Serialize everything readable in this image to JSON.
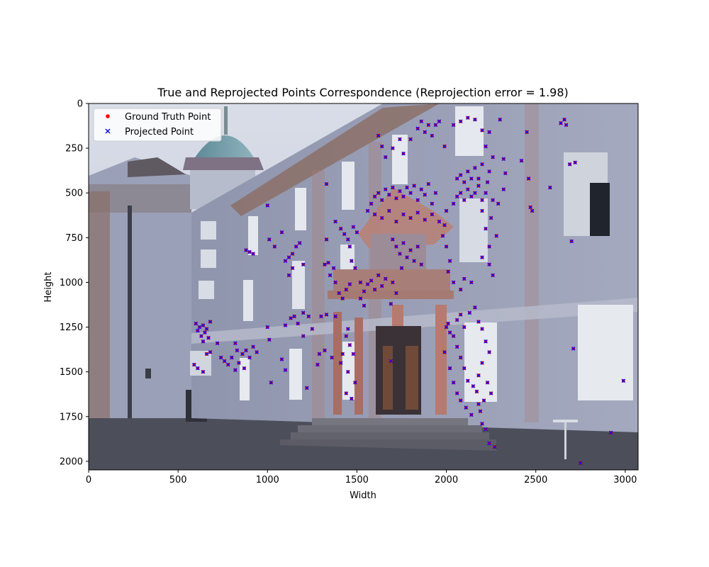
{
  "chart_data": {
    "type": "scatter",
    "title": "True and Reprojected Points Correspondence (Reprojection error = 1.98)",
    "xlabel": "Width",
    "ylabel": "Height",
    "xlim": [
      0,
      3072
    ],
    "ylim": [
      2048,
      0
    ],
    "x_ticks": [
      0,
      500,
      1000,
      1500,
      2000,
      2500,
      3000
    ],
    "y_ticks": [
      0,
      250,
      500,
      750,
      1000,
      1250,
      1500,
      1750,
      2000
    ],
    "grid": false,
    "legend_position": "top-left",
    "background": "photograph of a baroque palace facade with a central balcony over a columned entrance",
    "series": [
      {
        "name": "Ground Truth Point",
        "marker": "circle",
        "color": "#ff0000"
      },
      {
        "name": "Projected Point",
        "marker": "x",
        "color": "#0000ff"
      }
    ],
    "points": [
      [
        1330,
        450
      ],
      [
        1380,
        660
      ],
      [
        1410,
        700
      ],
      [
        1430,
        730
      ],
      [
        1450,
        760
      ],
      [
        1480,
        690
      ],
      [
        1500,
        720
      ],
      [
        1460,
        800
      ],
      [
        1470,
        880
      ],
      [
        1490,
        920
      ],
      [
        1520,
        1000
      ],
      [
        1540,
        1050
      ],
      [
        1560,
        1010
      ],
      [
        1580,
        990
      ],
      [
        1600,
        1040
      ],
      [
        1620,
        960
      ],
      [
        1640,
        1020
      ],
      [
        1660,
        980
      ],
      [
        1700,
        1000
      ],
      [
        1720,
        1060
      ],
      [
        1560,
        600
      ],
      [
        1580,
        560
      ],
      [
        1600,
        520
      ],
      [
        1620,
        500
      ],
      [
        1640,
        540
      ],
      [
        1660,
        480
      ],
      [
        1680,
        510
      ],
      [
        1700,
        470
      ],
      [
        1720,
        530
      ],
      [
        1740,
        490
      ],
      [
        1760,
        520
      ],
      [
        1780,
        470
      ],
      [
        1800,
        500
      ],
      [
        1820,
        460
      ],
      [
        1840,
        540
      ],
      [
        1860,
        480
      ],
      [
        1880,
        510
      ],
      [
        1900,
        450
      ],
      [
        1920,
        560
      ],
      [
        1940,
        500
      ],
      [
        1600,
        620
      ],
      [
        1640,
        640
      ],
      [
        1680,
        600
      ],
      [
        1720,
        660
      ],
      [
        1760,
        620
      ],
      [
        1800,
        640
      ],
      [
        1840,
        610
      ],
      [
        1880,
        650
      ],
      [
        1920,
        620
      ],
      [
        1960,
        660
      ],
      [
        1700,
        760
      ],
      [
        1720,
        800
      ],
      [
        1740,
        840
      ],
      [
        1760,
        780
      ],
      [
        1780,
        860
      ],
      [
        1800,
        820
      ],
      [
        1820,
        880
      ],
      [
        1840,
        800
      ],
      [
        1860,
        900
      ],
      [
        1750,
        920
      ],
      [
        2040,
        560
      ],
      [
        2060,
        520
      ],
      [
        2080,
        500
      ],
      [
        2100,
        540
      ],
      [
        2120,
        480
      ],
      [
        2140,
        520
      ],
      [
        2160,
        500
      ],
      [
        2180,
        460
      ],
      [
        2200,
        540
      ],
      [
        2220,
        500
      ],
      [
        2080,
        400
      ],
      [
        2120,
        380
      ],
      [
        2160,
        360
      ],
      [
        2200,
        340
      ],
      [
        2240,
        380
      ],
      [
        2060,
        420
      ],
      [
        2140,
        420
      ],
      [
        2180,
        420
      ],
      [
        2100,
        440
      ],
      [
        2230,
        440
      ],
      [
        2000,
        600
      ],
      [
        1990,
        680
      ],
      [
        1980,
        740
      ],
      [
        2000,
        800
      ],
      [
        2020,
        880
      ],
      [
        2010,
        940
      ],
      [
        2040,
        1000
      ],
      [
        2080,
        1040
      ],
      [
        2100,
        980
      ],
      [
        2140,
        1000
      ],
      [
        2240,
        900
      ],
      [
        2260,
        960
      ],
      [
        2200,
        860
      ],
      [
        2240,
        800
      ],
      [
        2280,
        740
      ],
      [
        2220,
        700
      ],
      [
        2250,
        640
      ],
      [
        2200,
        600
      ],
      [
        2290,
        560
      ],
      [
        2260,
        540
      ],
      [
        1620,
        180
      ],
      [
        1640,
        240
      ],
      [
        1660,
        300
      ],
      [
        1700,
        250
      ],
      [
        1740,
        200
      ],
      [
        1760,
        280
      ],
      [
        1800,
        200
      ],
      [
        1840,
        140
      ],
      [
        1860,
        100
      ],
      [
        1880,
        160
      ],
      [
        1900,
        120
      ],
      [
        1920,
        180
      ],
      [
        1940,
        120
      ],
      [
        1960,
        100
      ],
      [
        1990,
        240
      ],
      [
        2040,
        120
      ],
      [
        2080,
        100
      ],
      [
        2120,
        80
      ],
      [
        2160,
        90
      ],
      [
        2200,
        150
      ],
      [
        2240,
        160
      ],
      [
        2220,
        240
      ],
      [
        2260,
        300
      ],
      [
        2300,
        90
      ],
      [
        2320,
        310
      ],
      [
        2330,
        390
      ],
      [
        2320,
        480
      ],
      [
        2420,
        320
      ],
      [
        2450,
        160
      ],
      [
        2460,
        420
      ],
      [
        2470,
        580
      ],
      [
        2480,
        600
      ],
      [
        2580,
        470
      ],
      [
        2640,
        110
      ],
      [
        2660,
        90
      ],
      [
        2670,
        120
      ],
      [
        2690,
        340
      ],
      [
        2720,
        330
      ],
      [
        2700,
        770
      ],
      [
        2710,
        1370
      ],
      [
        2750,
        2010
      ],
      [
        2920,
        1840
      ],
      [
        2990,
        1550
      ],
      [
        2270,
        1920
      ],
      [
        2240,
        1900
      ],
      [
        2220,
        1820
      ],
      [
        2200,
        1790
      ],
      [
        2190,
        1720
      ],
      [
        2180,
        1680
      ],
      [
        2170,
        1610
      ],
      [
        2150,
        1580
      ],
      [
        2120,
        1550
      ],
      [
        2100,
        1480
      ],
      [
        2080,
        1420
      ],
      [
        2060,
        1360
      ],
      [
        2040,
        1300
      ],
      [
        2020,
        1280
      ],
      [
        2010,
        1230
      ],
      [
        2000,
        1250
      ],
      [
        1990,
        1390
      ],
      [
        2020,
        1480
      ],
      [
        2040,
        1560
      ],
      [
        2060,
        1620
      ],
      [
        2080,
        1660
      ],
      [
        2110,
        1700
      ],
      [
        2140,
        1740
      ],
      [
        2130,
        1170
      ],
      [
        2160,
        1140
      ],
      [
        2180,
        1220
      ],
      [
        2200,
        1260
      ],
      [
        2220,
        1330
      ],
      [
        2240,
        1390
      ],
      [
        2200,
        1450
      ],
      [
        2180,
        1520
      ],
      [
        2230,
        1560
      ],
      [
        2250,
        1620
      ],
      [
        2210,
        1660
      ],
      [
        2100,
        1250
      ],
      [
        2080,
        1180
      ],
      [
        2060,
        1210
      ],
      [
        600,
        1230
      ],
      [
        610,
        1270
      ],
      [
        620,
        1250
      ],
      [
        630,
        1300
      ],
      [
        640,
        1240
      ],
      [
        650,
        1280
      ],
      [
        660,
        1260
      ],
      [
        670,
        1310
      ],
      [
        680,
        1220
      ],
      [
        640,
        1330
      ],
      [
        590,
        1460
      ],
      [
        610,
        1480
      ],
      [
        640,
        1500
      ],
      [
        660,
        1400
      ],
      [
        680,
        1390
      ],
      [
        720,
        1340
      ],
      [
        740,
        1420
      ],
      [
        760,
        1440
      ],
      [
        780,
        1460
      ],
      [
        800,
        1420
      ],
      [
        820,
        1340
      ],
      [
        830,
        1380
      ],
      [
        840,
        1450
      ],
      [
        860,
        1400
      ],
      [
        880,
        1380
      ],
      [
        900,
        1420
      ],
      [
        920,
        1360
      ],
      [
        940,
        1390
      ],
      [
        820,
        1490
      ],
      [
        870,
        1480
      ],
      [
        880,
        820
      ],
      [
        900,
        830
      ],
      [
        920,
        840
      ],
      [
        1000,
        570
      ],
      [
        1010,
        760
      ],
      [
        1040,
        800
      ],
      [
        1080,
        720
      ],
      [
        1100,
        880
      ],
      [
        1120,
        860
      ],
      [
        1140,
        840
      ],
      [
        1160,
        800
      ],
      [
        1180,
        780
      ],
      [
        1200,
        900
      ],
      [
        1120,
        960
      ],
      [
        1140,
        920
      ],
      [
        1100,
        1240
      ],
      [
        1130,
        1200
      ],
      [
        1150,
        1190
      ],
      [
        1170,
        1230
      ],
      [
        1200,
        1170
      ],
      [
        1230,
        1190
      ],
      [
        1250,
        1260
      ],
      [
        1200,
        1300
      ],
      [
        1000,
        1250
      ],
      [
        1010,
        1320
      ],
      [
        1080,
        1430
      ],
      [
        1020,
        1560
      ],
      [
        1100,
        1490
      ],
      [
        1220,
        1590
      ],
      [
        1280,
        1460
      ],
      [
        1290,
        1400
      ],
      [
        1320,
        1380
      ],
      [
        1360,
        1420
      ],
      [
        1380,
        1190
      ],
      [
        1330,
        1180
      ],
      [
        1300,
        1190
      ],
      [
        1420,
        1400
      ],
      [
        1440,
        1300
      ],
      [
        1450,
        1260
      ],
      [
        1460,
        1350
      ],
      [
        1480,
        1400
      ],
      [
        1490,
        1560
      ],
      [
        1470,
        1650
      ],
      [
        1440,
        1620
      ],
      [
        1450,
        1500
      ],
      [
        1410,
        1450
      ],
      [
        1420,
        1090
      ],
      [
        1440,
        1040
      ],
      [
        1460,
        1010
      ],
      [
        1400,
        1060
      ],
      [
        1380,
        1000
      ],
      [
        1350,
        960
      ],
      [
        1370,
        920
      ],
      [
        1340,
        890
      ],
      [
        1320,
        900
      ],
      [
        1330,
        760
      ],
      [
        1690,
        1440
      ],
      [
        1520,
        1090
      ],
      [
        1540,
        1130
      ],
      [
        1690,
        1120
      ]
    ]
  },
  "legend": {
    "gt_label": "Ground Truth Point",
    "proj_label": "Projected Point"
  }
}
